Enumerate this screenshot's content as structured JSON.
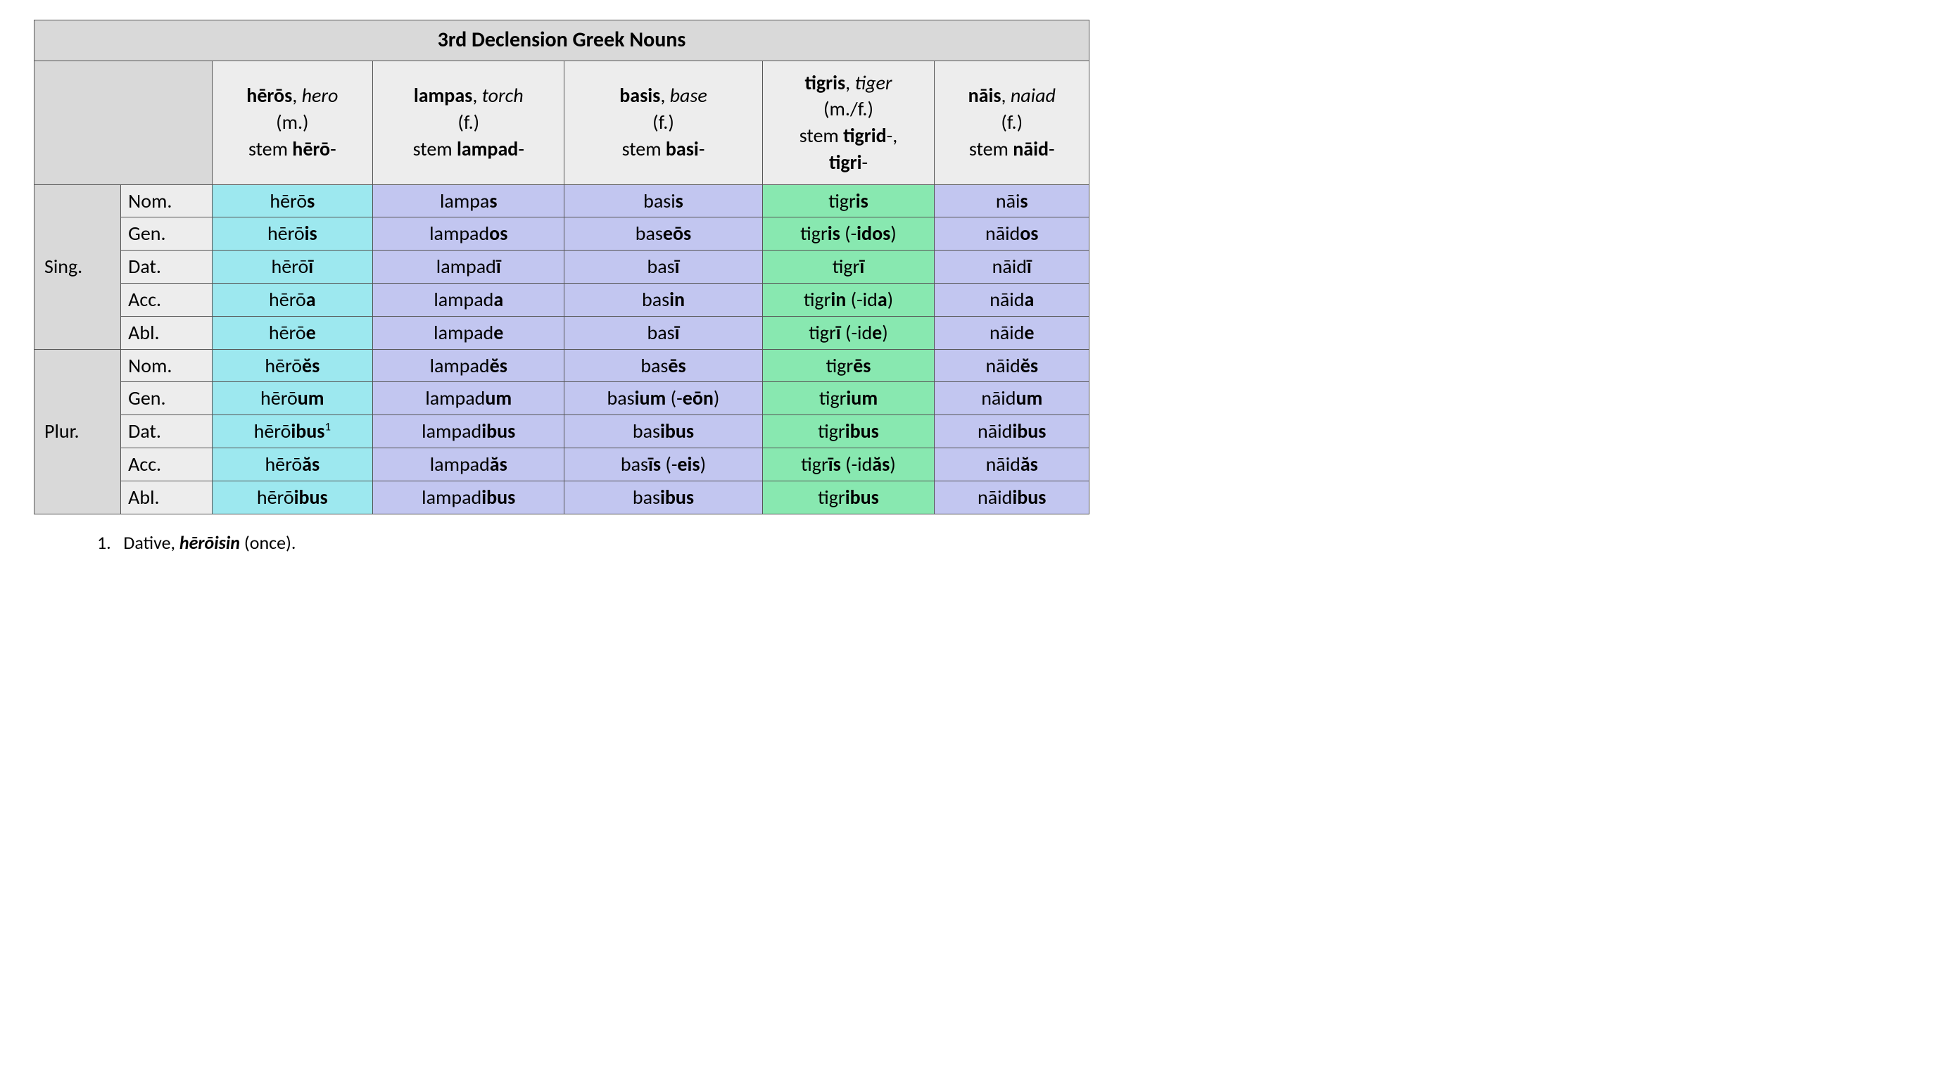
{
  "title": "3rd Declension Greek Nouns",
  "columns": [
    {
      "word": "hērōs",
      "gloss": "hero",
      "gender": "(m.)",
      "stemLabel": "stem ",
      "stem": "hērō",
      "stemSuffix": "-",
      "color": "cyan"
    },
    {
      "word": "lampas",
      "gloss": "torch",
      "gender": "(f.)",
      "stemLabel": "stem ",
      "stem": "lampad",
      "stemSuffix": "-",
      "color": "lav"
    },
    {
      "word": "basis",
      "gloss": "base",
      "gender": "(f.)",
      "stemLabel": "stem ",
      "stem": "basi",
      "stemSuffix": "-",
      "color": "lav"
    },
    {
      "word": "tigris",
      "gloss": "tiger",
      "gender": "(m./f.)",
      "stemLabel": "stem ",
      "stem": "tigrid",
      "stemSuffix": "-,",
      "stem2": "tigri",
      "stem2Suffix": "-",
      "color": "green"
    },
    {
      "word": "nāis",
      "gloss": "naiad",
      "gender": "(f.)",
      "stemLabel": "stem ",
      "stem": "nāid",
      "stemSuffix": "-",
      "color": "lav"
    }
  ],
  "groups": [
    {
      "label": "Sing.",
      "rows": [
        {
          "case": "Nom.",
          "cells": [
            {
              "pre": "hērō",
              "end": "s"
            },
            {
              "pre": "lampa",
              "end": "s"
            },
            {
              "pre": "basi",
              "end": "s"
            },
            {
              "pre": "tigr",
              "end": "is"
            },
            {
              "pre": "nāi",
              "end": "s"
            }
          ]
        },
        {
          "case": "Gen.",
          "cells": [
            {
              "pre": "hērō",
              "end": "is"
            },
            {
              "pre": "lampad",
              "end": "os"
            },
            {
              "pre": "bas",
              "end": "eōs"
            },
            {
              "pre": "tigr",
              "end": "is",
              "alt": "idos"
            },
            {
              "pre": "nāid",
              "end": "os"
            }
          ]
        },
        {
          "case": "Dat.",
          "cells": [
            {
              "pre": "hērō",
              "end": "ī"
            },
            {
              "pre": "lampad",
              "end": "ī"
            },
            {
              "pre": "bas",
              "end": "ī"
            },
            {
              "pre": "tigr",
              "end": "ī"
            },
            {
              "pre": "nāid",
              "end": "ī"
            }
          ]
        },
        {
          "case": "Acc.",
          "cells": [
            {
              "pre": "hērō",
              "end": "a"
            },
            {
              "pre": "lampad",
              "end": "a"
            },
            {
              "pre": "bas",
              "end": "in"
            },
            {
              "pre": "tigr",
              "end": "in",
              "altPre": "id",
              "altEnd": "a"
            },
            {
              "pre": "nāid",
              "end": "a"
            }
          ]
        },
        {
          "case": "Abl.",
          "cells": [
            {
              "pre": "hērō",
              "end": "e"
            },
            {
              "pre": "lampad",
              "end": "e"
            },
            {
              "pre": "bas",
              "end": "ī"
            },
            {
              "pre": "tigr",
              "end": "ī",
              "altPre": "id",
              "altEnd": "e"
            },
            {
              "pre": "nāid",
              "end": "e"
            }
          ]
        }
      ]
    },
    {
      "label": "Plur.",
      "rows": [
        {
          "case": "Nom.",
          "cells": [
            {
              "pre": "hērō",
              "end": "ĕs"
            },
            {
              "pre": "lampad",
              "end": "ĕs"
            },
            {
              "pre": "bas",
              "end": "ēs"
            },
            {
              "pre": "tigr",
              "end": "ēs"
            },
            {
              "pre": "nāid",
              "end": "ĕs"
            }
          ]
        },
        {
          "case": "Gen.",
          "cells": [
            {
              "pre": "hērō",
              "end": "um"
            },
            {
              "pre": "lampad",
              "end": "um"
            },
            {
              "pre": "bas",
              "end": "ium",
              "alt": "eōn"
            },
            {
              "pre": "tigr",
              "end": "ium"
            },
            {
              "pre": "nāid",
              "end": "um"
            }
          ]
        },
        {
          "case": "Dat.",
          "cells": [
            {
              "pre": "hērō",
              "end": "ibus",
              "sup": "1"
            },
            {
              "pre": "lampad",
              "end": "ibus"
            },
            {
              "pre": "bas",
              "end": "ibus"
            },
            {
              "pre": "tigr",
              "end": "ibus"
            },
            {
              "pre": "nāid",
              "end": "ibus"
            }
          ]
        },
        {
          "case": "Acc.",
          "cells": [
            {
              "pre": "hērō",
              "end": "ăs"
            },
            {
              "pre": "lampad",
              "end": "ăs"
            },
            {
              "pre": "bas",
              "end": "īs",
              "alt": "eis"
            },
            {
              "pre": "tigr",
              "end": "īs",
              "altPre": "id",
              "altEnd": "ăs"
            },
            {
              "pre": "nāid",
              "end": "ăs"
            }
          ]
        },
        {
          "case": "Abl.",
          "cells": [
            {
              "pre": "hērō",
              "end": "ibus"
            },
            {
              "pre": "lampad",
              "end": "ibus"
            },
            {
              "pre": "bas",
              "end": "ibus"
            },
            {
              "pre": "tigr",
              "end": "ibus"
            },
            {
              "pre": "nāid",
              "end": "ibus"
            }
          ]
        }
      ]
    }
  ],
  "footnote": {
    "num": "1.",
    "lead": "Dative, ",
    "word": "hērōisin",
    "tail": " (once)."
  }
}
